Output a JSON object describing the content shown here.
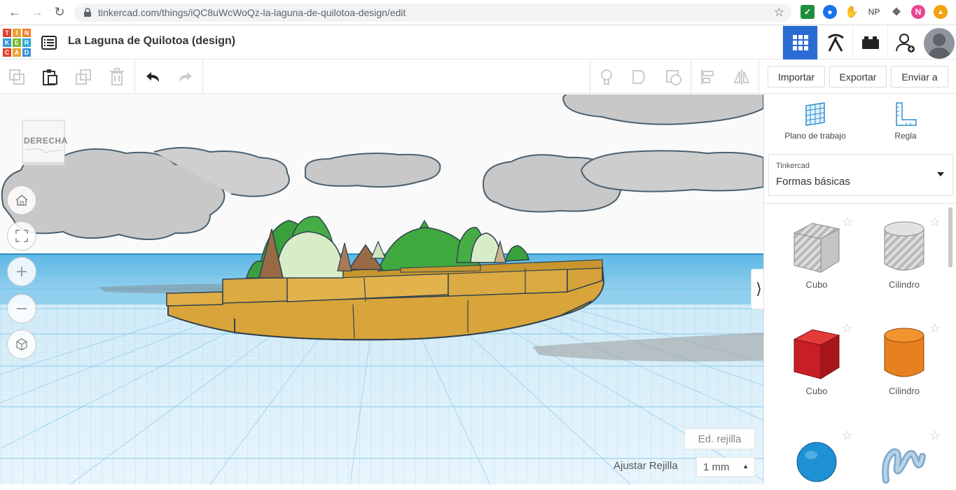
{
  "browser": {
    "url": "tinkercad.com/things/iQC8uWcWoQz-la-laguna-de-quilotoa-design/edit",
    "ext_np": "NP",
    "ext_n": "N"
  },
  "app": {
    "logo_letters": [
      "T",
      "I",
      "N",
      "K",
      "E",
      "R",
      "C",
      "A",
      "D"
    ],
    "logo_colors": [
      "#e2412f",
      "#e9a32f",
      "#f27d2c",
      "#3196d3",
      "#78b82a",
      "#2aa7d8",
      "#e2412f",
      "#e9a32f",
      "#3c8ddb"
    ],
    "design_title": "La Laguna de Quilotoa (design)"
  },
  "toolbar": {
    "import_label": "Importar",
    "export_label": "Exportar",
    "send_label": "Enviar a"
  },
  "viewport": {
    "viewcube_label": "DERECHA",
    "edit_grid_label": "Ed. rejilla",
    "snap_grid_label": "Ajustar Rejilla",
    "snap_grid_value": "1 mm"
  },
  "panel": {
    "workplane_label": "Plano de trabajo",
    "ruler_label": "Regla",
    "library_source": "Tinkercad",
    "library_name": "Formas básicas",
    "shapes": [
      {
        "label": "Cubo",
        "icon": "cube-striped-icon"
      },
      {
        "label": "Cilindro",
        "icon": "cylinder-striped-icon"
      },
      {
        "label": "Cubo",
        "icon": "cube-red-icon"
      },
      {
        "label": "Cilindro",
        "icon": "cylinder-orange-icon"
      },
      {
        "label": "",
        "icon": "sphere-blue-icon"
      },
      {
        "label": "",
        "icon": "scribble-icon"
      }
    ]
  },
  "colors": {
    "accent": "#2a6cd3",
    "grid_blue": "#5cb8e6",
    "island_gold": "#d9a53a"
  }
}
